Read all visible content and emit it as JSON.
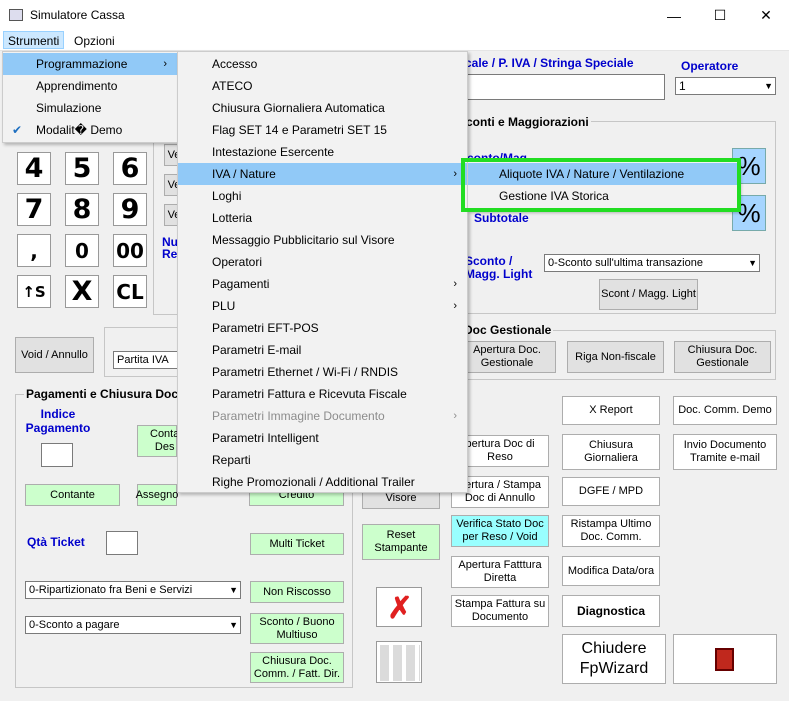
{
  "window": {
    "title": "Simulatore Cassa",
    "minimize": "—",
    "maximize": "☐",
    "close": "✕"
  },
  "menubar": {
    "strumenti": "Strumenti",
    "opzioni": "Opzioni"
  },
  "menu_strumenti": {
    "items": [
      {
        "label": "Programmazione",
        "arrow": "›"
      },
      {
        "label": "Apprendimento"
      },
      {
        "label": "Simulazione"
      },
      {
        "label": "Modalit� Demo",
        "check": "✔"
      }
    ]
  },
  "menu_programmazione": {
    "items": [
      "Accesso",
      "ATECO",
      "Chiusura Giornaliera Automatica",
      "Flag SET 14 e Parametri SET 15",
      "Intestazione Esercente",
      "IVA / Nature",
      "Loghi",
      "Lotteria",
      "Messaggio Pubblicitario sul Visore",
      "Operatori",
      "Pagamenti",
      "PLU",
      "Parametri EFT-POS",
      "Parametri E-mail",
      "Parametri Ethernet / Wi-Fi / RNDIS",
      "Parametri Fattura e Ricevuta Fiscale",
      "Parametri Immagine Documento",
      "Parametri Intelligent",
      "Reparti",
      "Righe Promozionali / Additional Trailer"
    ],
    "arrow": "›"
  },
  "menu_iva": {
    "items": [
      "Aliquote IVA / Nature / Ventilazione",
      "Gestione IVA Storica"
    ]
  },
  "header": {
    "cf_label": "cale / P. IVA / Stringa Speciale",
    "operatore_label": "Operatore",
    "operatore_value": "1"
  },
  "keypad": {
    "keys": [
      "4",
      "5",
      "6",
      "7",
      "8",
      "9",
      ",",
      "0",
      "00",
      "↑S",
      "X",
      "CL"
    ]
  },
  "partial_labels": {
    "v1": "Ve",
    "v2": "Ve",
    "v3": "Ve",
    "nu": "Nu",
    "re": "Re"
  },
  "sconti": {
    "title": "conti e Maggiorazioni",
    "sconto_mag": "conto/Mag",
    "subtotale": "Subtotale",
    "sconto_light": "Sconto / Magg. Light",
    "percent": "%",
    "combo_value": "0-Sconto sull'ultima transazione",
    "button": "Scont / Magg. Light"
  },
  "void_button": "Void / Annullo",
  "partita_iva_combo": "Partita IVA",
  "doc_gestionale": {
    "title": "Doc Gestionale",
    "apertura": "Apertura Doc. Gestionale",
    "riga": "Riga Non-fiscale",
    "chiusura": "Chiusura Doc. Gestionale"
  },
  "pagamenti": {
    "title": "Pagamenti e Chiusura Doc",
    "indice": "Indice Pagamento",
    "contante_desc": "Conta Des",
    "contante": "Contante",
    "assegno": "Assegno",
    "credito": "Credito",
    "qta_ticket": "Qtà Ticket",
    "multi_ticket": "Multi Ticket",
    "ripartizionato": "0-Ripartizionato fra Beni e Servizi",
    "non_riscosso": "Non Riscosso",
    "sconto_pagare": "0-Sconto a pagare",
    "sconto_buono": "Sconto / Buono Multiuso",
    "chiusura_doc": "Chiusura Doc. Comm. / Fatt. Dir."
  },
  "middle_buttons": {
    "visore": "Visore",
    "reset": "Reset Stampante",
    "apertura_reso": "pertura Doc di Reso",
    "apertura_annullo": "pertura / Stampa Doc di Annullo",
    "verifica": "Verifica Stato Doc per Reso / Void",
    "apertura_fattura": "Apertura Fatttura Diretta",
    "stampa_fattura": "Stampa Fattura su Documento"
  },
  "right_buttons": {
    "x_report": "X Report",
    "chiusura_giornaliera": "Chiusura Giornaliera",
    "dgfe": "DGFE / MPD",
    "ristampa": "Ristampa Ultimo Doc. Comm.",
    "modifica": "Modifica Data/ora",
    "diagnostica": "Diagnostica",
    "doc_demo": "Doc. Comm. Demo",
    "invio": "Invio Documento Tramite e-mail",
    "chiudere": "Chiudere FpWizard"
  },
  "colors": {
    "highlight": "#91c9f7",
    "green_outline": "#22dd22",
    "cyan": "#99ffff",
    "green": "#ccffcc",
    "blue_label": "#0000cc"
  }
}
